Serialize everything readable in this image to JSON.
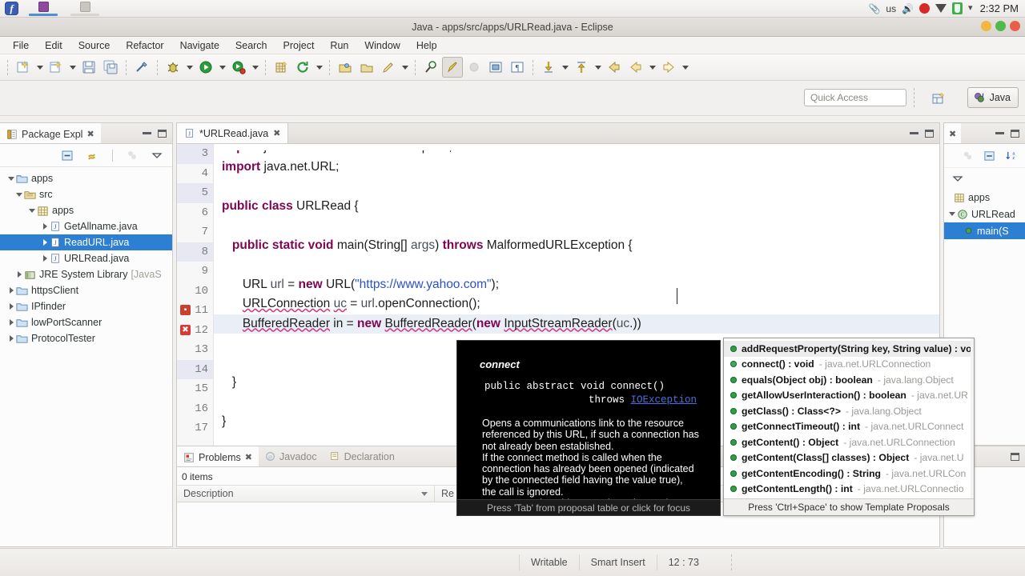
{
  "os_bar": {
    "keyboard_layout": "us",
    "time": "2:32 PM",
    "icons": [
      "paperclip-icon",
      "volume-icon",
      "record-icon",
      "wifi-icon",
      "battery-icon",
      "chevron-down-icon"
    ]
  },
  "window": {
    "title": "Java - apps/src/apps/URLRead.java - Eclipse"
  },
  "menu": {
    "items": [
      {
        "label": "File"
      },
      {
        "label": "Edit"
      },
      {
        "label": "Source"
      },
      {
        "label": "Refactor"
      },
      {
        "label": "Navigate"
      },
      {
        "label": "Search"
      },
      {
        "label": "Project"
      },
      {
        "label": "Run"
      },
      {
        "label": "Window"
      },
      {
        "label": "Help"
      }
    ]
  },
  "toolbar": {
    "buttons": [
      "new-wizard-icon",
      "new-java-class-icon",
      "save-icon",
      "save-all-icon",
      "toggle-mark-occurrences-icon",
      "debug-icon",
      "run-icon",
      "run-external-tools-icon",
      "new-java-package-icon",
      "refresh-icon",
      "open-type-icon",
      "open-task-icon",
      "search-icon",
      "toggle-breakpoint-icon",
      "next-annotation-icon",
      "previous-annotation-icon",
      "back-icon",
      "forward-icon"
    ]
  },
  "quick_access": {
    "placeholder": "Quick Access",
    "open_perspective_label": "open-perspective-icon",
    "perspective": "Java"
  },
  "package_explorer": {
    "tab_label": "Package Expl",
    "toolbar_icons": [
      "collapse-all-icon",
      "link-with-editor-icon",
      "focus-icon",
      "view-menu-icon"
    ],
    "tree": [
      {
        "label": "apps",
        "depth": 0,
        "icon": "project-folder-icon",
        "expanded": true,
        "selected": false
      },
      {
        "label": "src",
        "depth": 1,
        "icon": "source-folder-icon",
        "expanded": true,
        "selected": false
      },
      {
        "label": "apps",
        "depth": 2,
        "icon": "package-icon",
        "expanded": true,
        "selected": false
      },
      {
        "label": "GetAllname.java",
        "depth": 3,
        "icon": "java-file-icon",
        "expanded": false,
        "selected": false
      },
      {
        "label": "ReadURL.java",
        "depth": 3,
        "icon": "java-file-icon",
        "expanded": false,
        "selected": true
      },
      {
        "label": "URLRead.java",
        "depth": 3,
        "icon": "java-file-icon",
        "expanded": false,
        "selected": false
      },
      {
        "label": "JRE System Library",
        "suffix": "[JavaS",
        "depth": 1,
        "icon": "library-icon",
        "expanded": false,
        "selected": false
      },
      {
        "label": "httpsClient",
        "depth": 0,
        "icon": "closed-project-icon",
        "expanded": false,
        "selected": false
      },
      {
        "label": "IPfinder",
        "depth": 0,
        "icon": "closed-project-icon",
        "expanded": false,
        "selected": false
      },
      {
        "label": "lowPortScanner",
        "depth": 0,
        "icon": "closed-project-icon",
        "expanded": false,
        "selected": false
      },
      {
        "label": "ProtocolTester",
        "depth": 0,
        "icon": "closed-project-icon",
        "expanded": false,
        "selected": false
      }
    ]
  },
  "editor": {
    "tab_label": "*URLRead.java",
    "lines": [
      {
        "number": "3",
        "fold": true,
        "error": null,
        "highlight": false,
        "clipped": true
      },
      {
        "number": "4",
        "fold": false,
        "error": null,
        "highlight": false
      },
      {
        "number": "5",
        "fold": false,
        "error": null,
        "highlight": false
      },
      {
        "number": "6",
        "fold": false,
        "error": null,
        "highlight": false
      },
      {
        "number": "7",
        "fold": false,
        "error": null,
        "highlight": false
      },
      {
        "number": "8",
        "fold": true,
        "error": null,
        "highlight": false
      },
      {
        "number": "9",
        "fold": false,
        "error": null,
        "highlight": false
      },
      {
        "number": "10",
        "fold": false,
        "error": null,
        "highlight": false
      },
      {
        "number": "11",
        "fold": false,
        "error": "warning",
        "highlight": false
      },
      {
        "number": "12",
        "fold": false,
        "error": "error",
        "highlight": true
      },
      {
        "number": "13",
        "fold": false,
        "error": null,
        "highlight": false
      },
      {
        "number": "14",
        "fold": false,
        "error": null,
        "highlight": false
      },
      {
        "number": "15",
        "fold": false,
        "error": null,
        "highlight": false
      },
      {
        "number": "16",
        "fold": false,
        "error": null,
        "highlight": false
      },
      {
        "number": "17",
        "fold": false,
        "error": null,
        "highlight": false
      }
    ],
    "code_text": [
      "import java.net.MalformedURLException;",
      "import java.net.URL;",
      "",
      "public class URLRead {",
      "",
      "    public static void main(String[] args) throws MalformedURLException {",
      "",
      "        URL url = new URL(\"https://www.yahoo.com\");",
      "        URLConnection uc = url.openConnection();",
      "        BufferedReader in = new BufferedReader(new InputStreamReader(uc.))",
      "",
      "",
      "    }",
      "",
      "}"
    ]
  },
  "outline": {
    "toolbar_icons": [
      "focus-icon",
      "collapse-all-icon",
      "sort-icon",
      "view-menu-icon"
    ],
    "nodes": [
      {
        "label": "apps",
        "depth": 0,
        "icon": "package-icon",
        "expanded": false,
        "selected": false
      },
      {
        "label": "URLRead",
        "depth": 0,
        "icon": "class-icon",
        "expanded": true,
        "selected": false
      },
      {
        "label": "main(S",
        "depth": 1,
        "icon": "method-icon",
        "expanded": false,
        "selected": true
      }
    ]
  },
  "problems_panel": {
    "tabs": [
      {
        "label": "Problems",
        "icon": "problems-icon",
        "active": true
      },
      {
        "label": "Javadoc",
        "icon": "javadoc-icon",
        "active": false
      },
      {
        "label": "Declaration",
        "icon": "declaration-icon",
        "active": false
      }
    ],
    "item_count": "0 items",
    "columns": [
      {
        "label": "Description"
      },
      {
        "label": "Re"
      }
    ]
  },
  "javadoc_popup": {
    "title": "connect",
    "signature_line1": "public abstract void connect()",
    "signature_throws": "throws ",
    "signature_exception": "IOException",
    "body": [
      "Opens a communications link to the resource",
      "referenced by this URL, if such a connection has",
      "not already been established.",
      "If the connect method is called when the",
      "connection has already been opened (indicated",
      "by the connected field having the value true),",
      "the call is ignored.",
      "URLConnection objects go through two phases:"
    ],
    "footer": "Press 'Tab' from proposal table or click for focus"
  },
  "completion_popup": {
    "items": [
      {
        "signature": "addRequestProperty(String key, String value) : vo",
        "owner": "",
        "icon": "public-method-icon",
        "selected": true
      },
      {
        "signature": "connect() : void",
        "owner": "- java.net.URLConnection",
        "icon": "abstract-method-icon",
        "selected": false
      },
      {
        "signature": "equals(Object obj) : boolean",
        "owner": "- java.lang.Object",
        "icon": "public-method-icon",
        "selected": false
      },
      {
        "signature": "getAllowUserInteraction() : boolean",
        "owner": "- java.net.UR",
        "icon": "public-method-icon",
        "selected": false
      },
      {
        "signature": "getClass() : Class<?>",
        "owner": "- java.lang.Object",
        "icon": "public-method-icon",
        "selected": false
      },
      {
        "signature": "getConnectTimeout() : int",
        "owner": "- java.net.URLConnect",
        "icon": "public-method-icon",
        "selected": false
      },
      {
        "signature": "getContent() : Object",
        "owner": "- java.net.URLConnection",
        "icon": "public-method-icon",
        "selected": false
      },
      {
        "signature": "getContent(Class[] classes) : Object",
        "owner": "- java.net.U",
        "icon": "public-method-icon",
        "selected": false
      },
      {
        "signature": "getContentEncoding() : String",
        "owner": "- java.net.URLCon",
        "icon": "public-method-icon",
        "selected": false
      },
      {
        "signature": "getContentLength() : int",
        "owner": "- java.net.URLConnectio",
        "icon": "public-method-icon",
        "selected": false
      }
    ],
    "footer": "Press 'Ctrl+Space' to show Template Proposals"
  },
  "status_bar": {
    "writable": "Writable",
    "insert_mode": "Smart Insert",
    "cursor_position": "12 : 73"
  },
  "colors": {
    "selection_blue": "#2d7fd3",
    "keyword_purple": "#7d0552",
    "string_blue": "#2a52c9",
    "error_red": "#d93a35",
    "accent_green": "#2e9e49"
  }
}
